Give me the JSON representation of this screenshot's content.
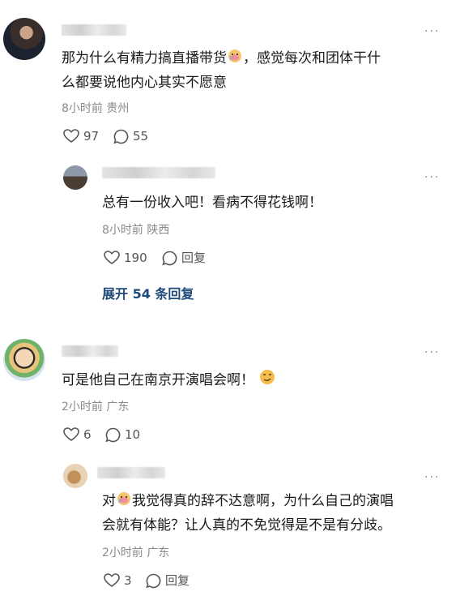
{
  "comments": [
    {
      "text": "那为什么有精力搞直播带货，感觉每次和团体干什么都要说他内心其实不愿意",
      "text_line1_a": "那为什么有精力搞直播带货",
      "text_line1_b": "，感觉每次和团体干什",
      "text_line2": "么都要说他内心其实不愿意",
      "meta": "8小时前 贵州",
      "likes": "97",
      "replies": "55",
      "emoji_icon": "crying-face-icon",
      "reply": {
        "text": "总有一份收入吧！看病不得花钱啊！",
        "meta": "8小时前 陕西",
        "likes": "190",
        "reply_label": "回复"
      },
      "expand_label": "展开 54 条回复"
    },
    {
      "text_before_emoji": "可是他自己在南京开演唱会啊！",
      "emoji_icon": "smirk-face-icon",
      "meta": "2小时前 广东",
      "likes": "6",
      "replies": "10",
      "reply": {
        "text_prefix": "对",
        "text_line1": "我觉得真的辞不达意啊，为什么自己的演唱",
        "text_line2": "会就有体能？让人真的不免觉得是不是有分歧。",
        "meta": "2小时前 广东",
        "likes": "3",
        "reply_label": "回复"
      }
    }
  ],
  "more_label": "···"
}
